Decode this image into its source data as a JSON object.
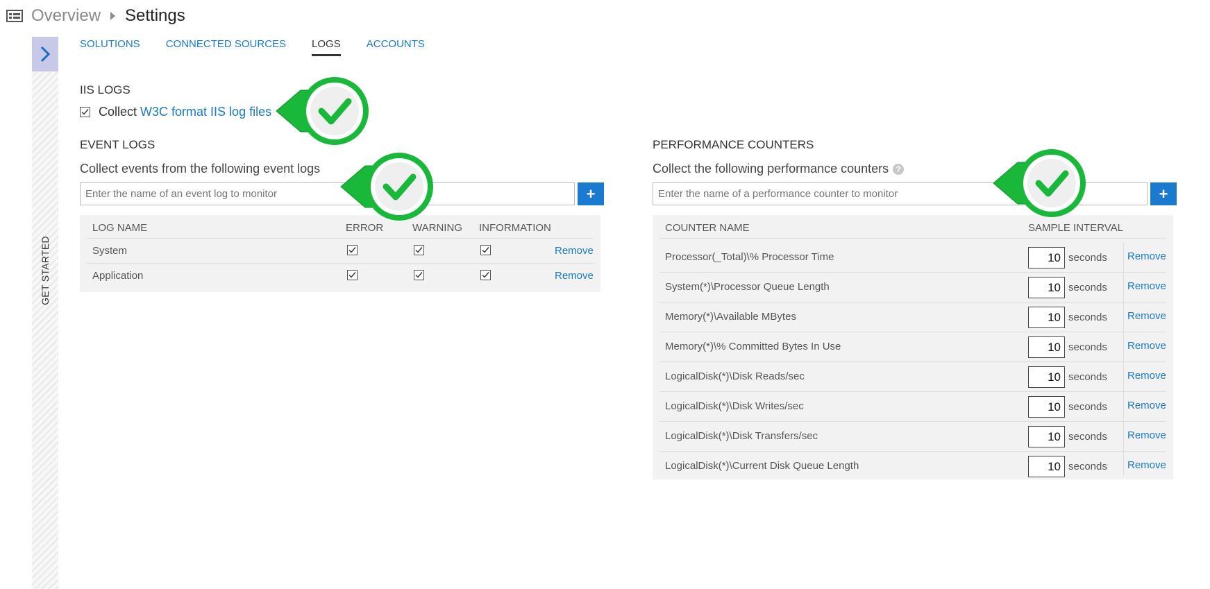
{
  "breadcrumb": {
    "overview": "Overview",
    "current": "Settings"
  },
  "rail": {
    "label": "GET STARTED"
  },
  "tabs": [
    {
      "label": "SOLUTIONS"
    },
    {
      "label": "CONNECTED SOURCES"
    },
    {
      "label": "LOGS"
    },
    {
      "label": "ACCOUNTS"
    }
  ],
  "iis": {
    "title": "IIS LOGS",
    "collect_text": "Collect",
    "collect_link": "W3C format IIS log files",
    "checked": true
  },
  "event_logs": {
    "title": "EVENT LOGS",
    "subtitle": "Collect events from the following event logs",
    "placeholder": "Enter the name of an event log to monitor",
    "add_label": "+",
    "headers": {
      "name": "LOG NAME",
      "error": "ERROR",
      "warning": "WARNING",
      "information": "INFORMATION"
    },
    "rows": [
      {
        "name": "System",
        "remove": "Remove"
      },
      {
        "name": "Application",
        "remove": "Remove"
      }
    ]
  },
  "perf": {
    "title": "PERFORMANCE COUNTERS",
    "subtitle": "Collect the following performance counters",
    "help": "?",
    "placeholder": "Enter the name of a performance counter to monitor",
    "add_label": "+",
    "headers": {
      "name": "COUNTER NAME",
      "interval": "SAMPLE INTERVAL"
    },
    "unit": "seconds",
    "rows": [
      {
        "name": "Processor(_Total)\\% Processor Time",
        "interval": "10",
        "remove": "Remove"
      },
      {
        "name": "System(*)\\Processor Queue Length",
        "interval": "10",
        "remove": "Remove"
      },
      {
        "name": "Memory(*)\\Available MBytes",
        "interval": "10",
        "remove": "Remove"
      },
      {
        "name": "Memory(*)\\% Committed Bytes In Use",
        "interval": "10",
        "remove": "Remove"
      },
      {
        "name": "LogicalDisk(*)\\Disk Reads/sec",
        "interval": "10",
        "remove": "Remove"
      },
      {
        "name": "LogicalDisk(*)\\Disk Writes/sec",
        "interval": "10",
        "remove": "Remove"
      },
      {
        "name": "LogicalDisk(*)\\Disk Transfers/sec",
        "interval": "10",
        "remove": "Remove"
      },
      {
        "name": "LogicalDisk(*)\\Current Disk Queue Length",
        "interval": "10",
        "remove": "Remove"
      }
    ]
  },
  "colors": {
    "accent": "#1a7ac8",
    "badge_green": "#1ab83a"
  },
  "icons": [
    "server-icon",
    "chevron-right-icon",
    "checkbox-checked-icon",
    "plus-icon",
    "help-icon",
    "check-badge-icon"
  ]
}
